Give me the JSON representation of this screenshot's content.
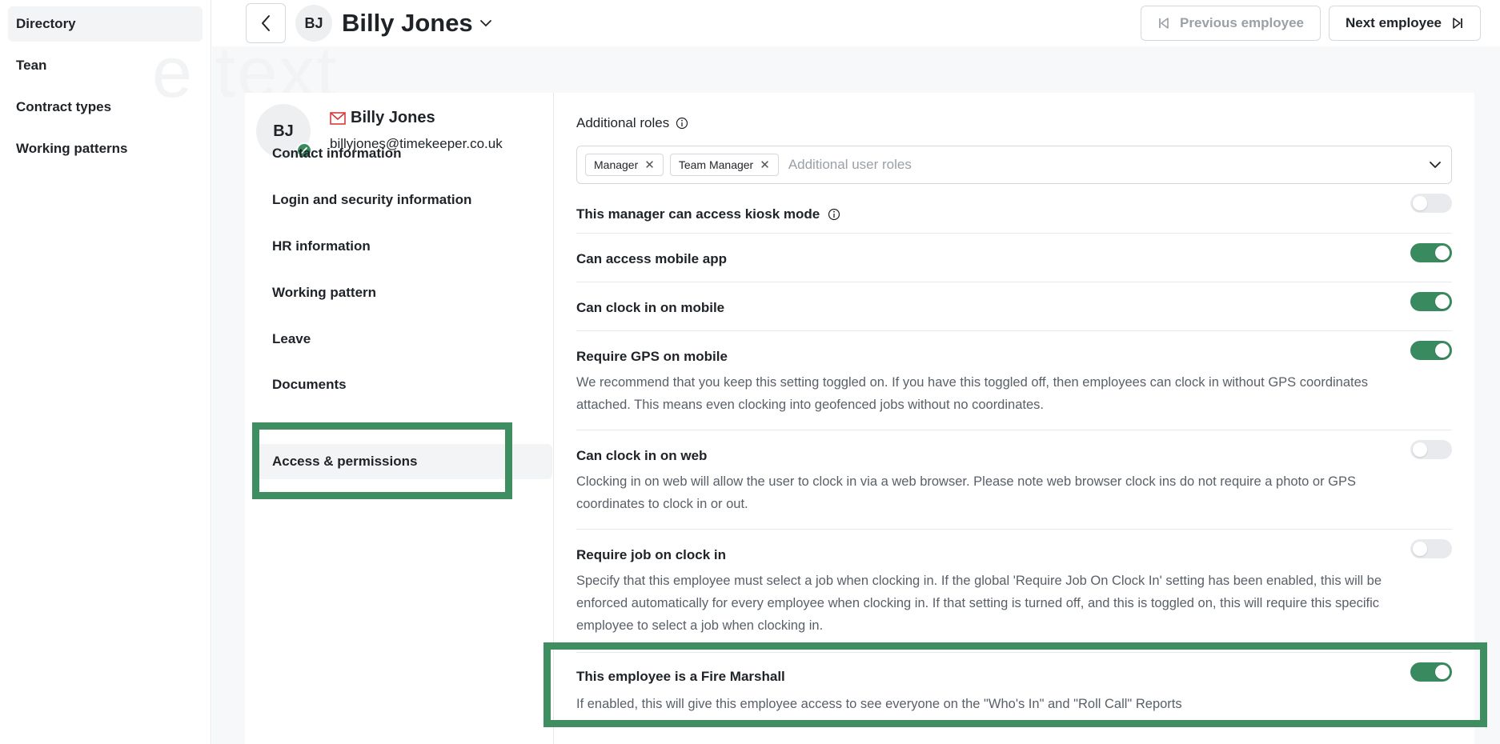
{
  "app_nav": {
    "items": [
      {
        "label": "Directory",
        "active": true
      },
      {
        "label": "Tean",
        "active": false
      },
      {
        "label": "Contract types",
        "active": false
      },
      {
        "label": "Working patterns",
        "active": false
      }
    ],
    "watermark": "e text"
  },
  "header": {
    "initials": "BJ",
    "name": "Billy Jones",
    "prev_label": "Previous employee",
    "next_label": "Next employee"
  },
  "employee": {
    "initials": "BJ",
    "name": "Billy Jones",
    "email": "billyjones@timekeeper.co.uk"
  },
  "subnav": {
    "items": [
      {
        "label": "Contact information"
      },
      {
        "label": "Login and security information"
      },
      {
        "label": "HR information"
      },
      {
        "label": "Working pattern"
      },
      {
        "label": "Leave"
      },
      {
        "label": "Documents"
      },
      {
        "label": "Access & permissions"
      }
    ]
  },
  "roles": {
    "label": "Additional roles",
    "chips": [
      "Manager",
      "Team Manager"
    ],
    "placeholder": "Additional user roles"
  },
  "settings": [
    {
      "title": "This manager can access kiosk mode",
      "desc": "",
      "on": false
    },
    {
      "title": "Can access mobile app",
      "desc": "",
      "on": true
    },
    {
      "title": "Can clock in on mobile",
      "desc": "",
      "on": true
    },
    {
      "title": "Require GPS on mobile",
      "desc": "We recommend that you keep this setting toggled on. If you have this toggled off, then employees can clock in without GPS coordinates attached. This means even clocking into geofenced jobs without no coordinates.",
      "on": true
    },
    {
      "title": "Can clock in on web",
      "desc": "Clocking in on web will allow the user to clock in via a web browser. Please note web browser clock ins do not require a photo or GPS coordinates to clock in or out.",
      "on": false
    },
    {
      "title": "Require job on clock in",
      "desc": "Specify that this employee must select a job when clocking in. If the global 'Require Job On Clock In' setting has been enabled, this will be enforced automatically for every employee when clocking in. If that setting is turned off, and this is toggled on, this will require this specific employee to select a job when clocking in.",
      "on": false
    },
    {
      "title": "This employee is a Fire Marshall",
      "desc": "If enabled, this will give this employee access to see everyone on the \"Who's In\" and \"Roll Call\" Reports",
      "on": true
    }
  ],
  "colors": {
    "accent_green": "#3a8a5f",
    "highlight_green": "#3e8e62",
    "mail_red": "#d63b3b"
  }
}
